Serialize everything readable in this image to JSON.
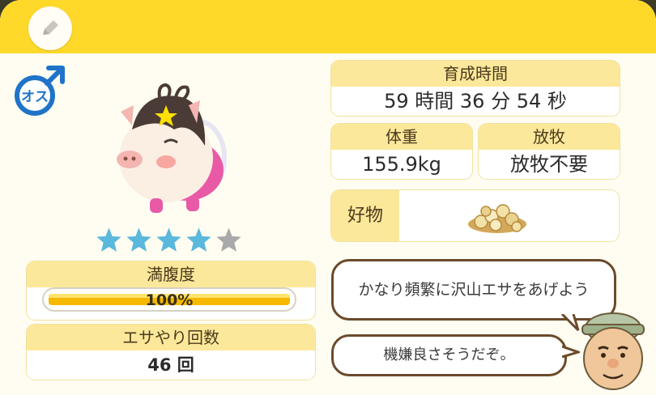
{
  "raise_time": {
    "label": "育成時間",
    "value": "59 時間 36 分 54 秒"
  },
  "weight": {
    "label": "体重",
    "value": "155.9kg"
  },
  "grazing": {
    "label": "放牧",
    "value": "放牧不要"
  },
  "favorite": {
    "label": "好物",
    "item_icon": "grain-icon"
  },
  "rating": {
    "filled": 4,
    "total": 5
  },
  "satiety": {
    "label": "満腹度",
    "value": "100%",
    "level": 1.0
  },
  "feed_count": {
    "label": "エサやり回数",
    "value": "46 回"
  },
  "sex": {
    "label": "オス",
    "icon": "male-symbol-icon"
  },
  "advice": {
    "message_1": "かなり頻繁に沢山エサをあげよう",
    "message_2": "機嫌良さそうだぞ。"
  },
  "colors": {
    "accent": "#ffd92a",
    "header_fill": "#fce89a",
    "star_on": "#5ab8dc",
    "star_off": "#a9a9a9",
    "gauge": "#f6b800",
    "male_blue": "#1f73c8"
  }
}
